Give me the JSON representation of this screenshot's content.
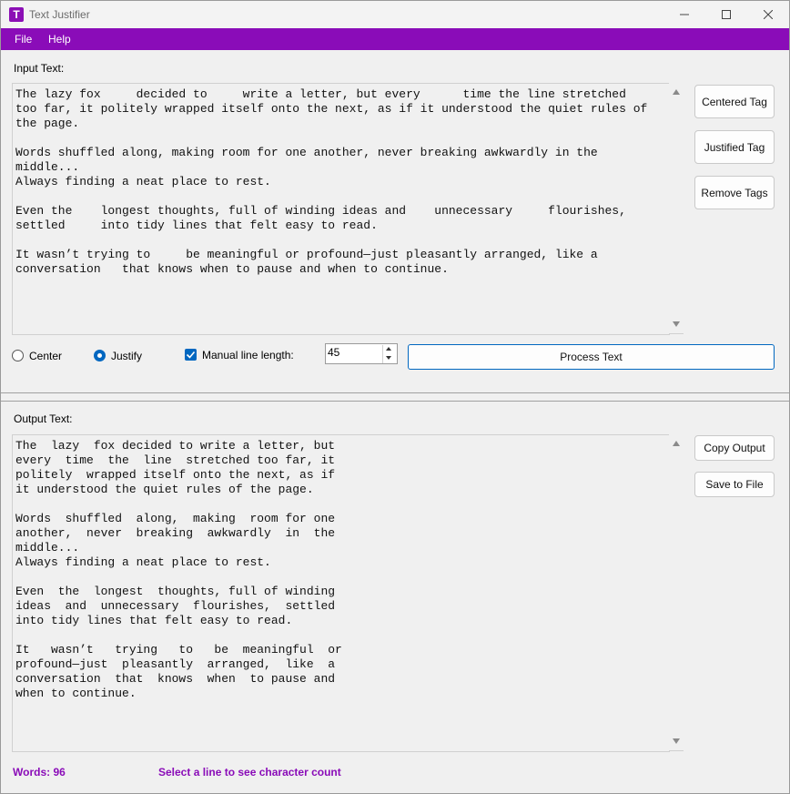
{
  "window": {
    "title": "Text Justifier",
    "icon_letter": "T",
    "controls": [
      "minimize-icon",
      "maximize-icon",
      "close-icon"
    ]
  },
  "menu": {
    "items": [
      "File",
      "Help"
    ],
    "background": "#8a0cb8"
  },
  "input": {
    "label": "Input Text:",
    "text": "The lazy fox     decided to     write a letter, but every      time the line stretched\ntoo far, it politely wrapped itself onto the next, as if it understood the quiet rules of\nthe page.\n\nWords shuffled along, making room for one another, never breaking awkwardly in the\nmiddle...\nAlways finding a neat place to rest.\n\nEven the    longest thoughts, full of winding ideas and    unnecessary     flourishes,\nsettled     into tidy lines that felt easy to read.\n\nIt wasn’t trying to     be meaningful or profound—just pleasantly arranged, like a\nconversation   that knows when to pause and when to continue."
  },
  "tag_buttons": {
    "centered": "Centered Tag",
    "justified": "Justified Tag",
    "remove": "Remove Tags"
  },
  "options": {
    "center_label": "Center",
    "justify_label": "Justify",
    "selected_alignment": "Justify",
    "manual_label": "Manual line length:",
    "manual_checked": true,
    "line_length": "45",
    "process_label": "Process Text"
  },
  "output": {
    "label": "Output Text:",
    "text": "The  lazy  fox decided to write a letter, but\nevery  time  the  line  stretched too far, it\npolitely  wrapped itself onto the next, as if\nit understood the quiet rules of the page.\n\nWords  shuffled  along,  making  room for one\nanother,  never  breaking  awkwardly  in  the\nmiddle...\nAlways finding a neat place to rest.\n\nEven  the  longest  thoughts, full of winding\nideas  and  unnecessary  flourishes,  settled\ninto tidy lines that felt easy to read.\n\nIt   wasn’t   trying   to   be  meaningful  or\nprofound—just  pleasantly  arranged,  like  a\nconversation  that  knows  when  to pause and\nwhen to continue."
  },
  "output_buttons": {
    "copy": "Copy Output",
    "save": "Save to File"
  },
  "status": {
    "words": "Words: 96",
    "hint": "Select a line to see character count",
    "color": "#8a0cb8"
  }
}
